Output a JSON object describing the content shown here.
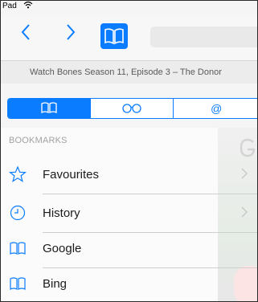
{
  "status_bar": {
    "device": "Pad",
    "wifi_icon": "wifi-icon"
  },
  "toolbar": {
    "back_icon": "chevron-left-icon",
    "forward_icon": "chevron-right-icon",
    "bookmarks_icon": "book-icon"
  },
  "page": {
    "title": "Watch Bones Season 11, Episode 3 – The Donor"
  },
  "segments": [
    {
      "name": "bookmarks",
      "icon": "book-icon",
      "selected": true
    },
    {
      "name": "reading-list",
      "icon": "glasses-icon",
      "selected": false
    },
    {
      "name": "shared-links",
      "icon": "at-icon",
      "glyph": "@",
      "selected": false
    }
  ],
  "section": {
    "header": "BOOKMARKS"
  },
  "rows": [
    {
      "label": "Favourites",
      "icon": "star-icon",
      "has_chevron": true
    },
    {
      "label": "History",
      "icon": "clock-icon",
      "has_chevron": true
    },
    {
      "label": "Google",
      "icon": "book-icon",
      "has_chevron": false
    },
    {
      "label": "Bing",
      "icon": "book-icon",
      "has_chevron": false
    }
  ],
  "colors": {
    "accent": "#0a7cff",
    "separator": "#cfcfcf",
    "header_text": "#a2a2a2"
  }
}
